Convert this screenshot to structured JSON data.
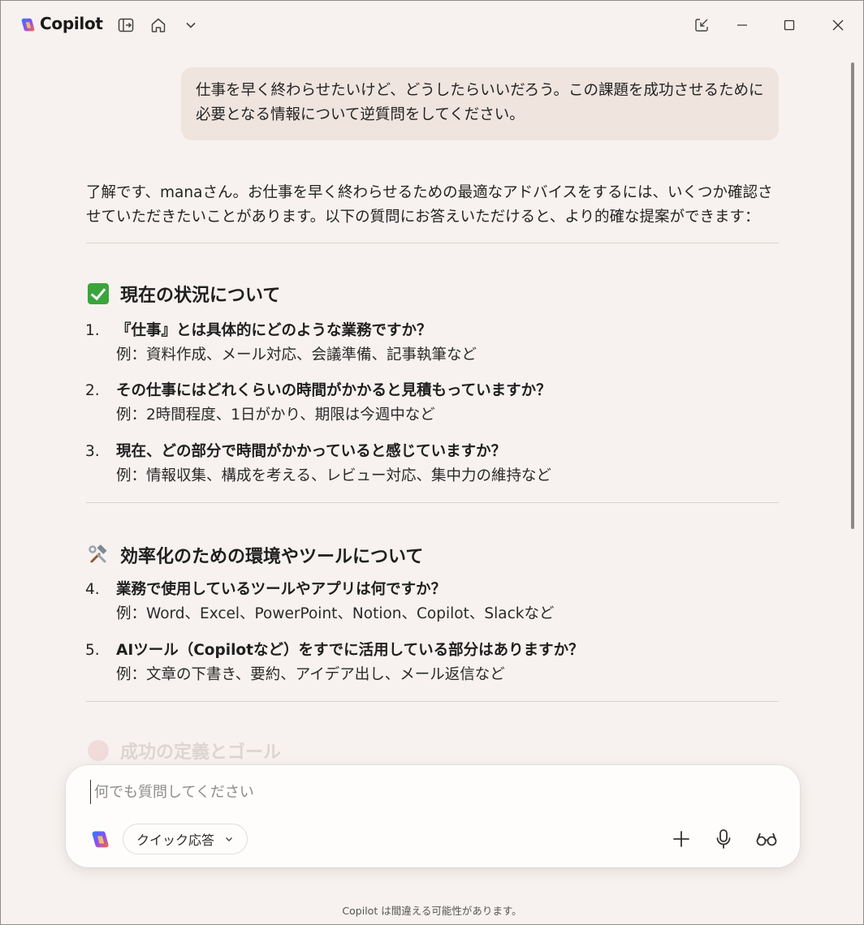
{
  "app": {
    "title": "Copilot"
  },
  "chat": {
    "user_message": "仕事を早く終わらせたいけど、どうしたらいいだろう。この課題を成功させるために必要となる情報について逆質問をしてください。",
    "intro": "了解です、manaさん。お仕事を早く終わらせるための最適なアドバイスをするには、いくつか確認させていただきたいことがあります。以下の質問にお答えいただけると、より的確な提案ができます：",
    "sections": [
      {
        "icon": "check-mark-icon",
        "title": "現在の状況について",
        "items": [
          {
            "num": "1.",
            "q": "『仕事』とは具体的にどのような業務ですか？",
            "ex": "例：資料作成、メール対応、会議準備、記事執筆など"
          },
          {
            "num": "2.",
            "q": "その仕事にはどれくらいの時間がかかると見積もっていますか？",
            "ex": "例：2時間程度、1日がかり、期限は今週中など"
          },
          {
            "num": "3.",
            "q": "現在、どの部分で時間がかかっていると感じていますか？",
            "ex": "例：情報収集、構成を考える、レビュー対応、集中力の維持など"
          }
        ]
      },
      {
        "icon": "hammer-wrench-icon",
        "title": "効率化のための環境やツールについて",
        "items": [
          {
            "num": "4.",
            "q": "業務で使用しているツールやアプリは何ですか？",
            "ex": "例：Word、Excel、PowerPoint、Notion、Copilot、Slackなど"
          },
          {
            "num": "5.",
            "q": "AIツール（Copilotなど）をすでに活用している部分はありますか？",
            "ex": "例：文章の下書き、要約、アイデア出し、メール返信など"
          }
        ]
      }
    ],
    "faded_section_title": "成功の定義とゴール"
  },
  "composer": {
    "placeholder": "何でも質問してください",
    "mode_label": "クイック応答"
  },
  "footer": {
    "disclaimer": "Copilot は間違える可能性があります。"
  },
  "colors": {
    "background": "#f7f2ef",
    "user_bubble": "#efe4de",
    "composer": "#fffdfc",
    "check_green": "#3aa53a"
  }
}
